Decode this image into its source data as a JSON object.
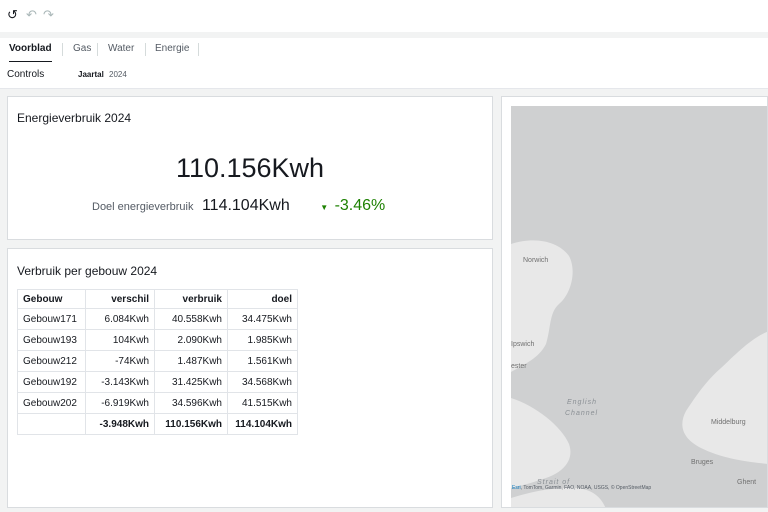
{
  "toolbar": {
    "undo_icon": "undo-icon",
    "redo_icon": "redo-icon",
    "reset_icon": "reset-icon"
  },
  "tabs": [
    {
      "label": "Voorblad",
      "active": true
    },
    {
      "label": "Gas",
      "active": false
    },
    {
      "label": "Water",
      "active": false
    },
    {
      "label": "Energie",
      "active": false
    }
  ],
  "controls": {
    "label": "Controls",
    "filter_label": "Jaartal",
    "filter_value": "2024"
  },
  "kpi": {
    "title": "Energieverbruik 2024",
    "value": "110.156Kwh",
    "target_label": "Doel energieverbruik",
    "target_value": "114.104Kwh",
    "delta": "-3.46%",
    "delta_color": "#1d8102"
  },
  "building_table": {
    "title": "Verbruik per gebouw 2024",
    "headers": [
      "Gebouw",
      "verschil",
      "verbruik",
      "doel"
    ],
    "rows": [
      [
        "Gebouw171",
        "6.084Kwh",
        "40.558Kwh",
        "34.475Kwh"
      ],
      [
        "Gebouw193",
        "104Kwh",
        "2.090Kwh",
        "1.985Kwh"
      ],
      [
        "Gebouw212",
        "-74Kwh",
        "1.487Kwh",
        "1.561Kwh"
      ],
      [
        "Gebouw192",
        "-3.143Kwh",
        "31.425Kwh",
        "34.568Kwh"
      ],
      [
        "Gebouw202",
        "-6.919Kwh",
        "34.596Kwh",
        "41.515Kwh"
      ]
    ],
    "total": [
      "",
      "-3.948Kwh",
      "110.156Kwh",
      "114.104Kwh"
    ]
  },
  "map": {
    "places": [
      "Norwich",
      "Ipswich",
      "ester",
      "Middelburg",
      "Bruges",
      "Ghent"
    ],
    "sea_labels": [
      "English",
      "Channel",
      "Strait of"
    ],
    "attribution_link": "Esri",
    "attribution": ", TomTom, Garmin, FAO, NOAA, USGS, © OpenStreetMap"
  }
}
